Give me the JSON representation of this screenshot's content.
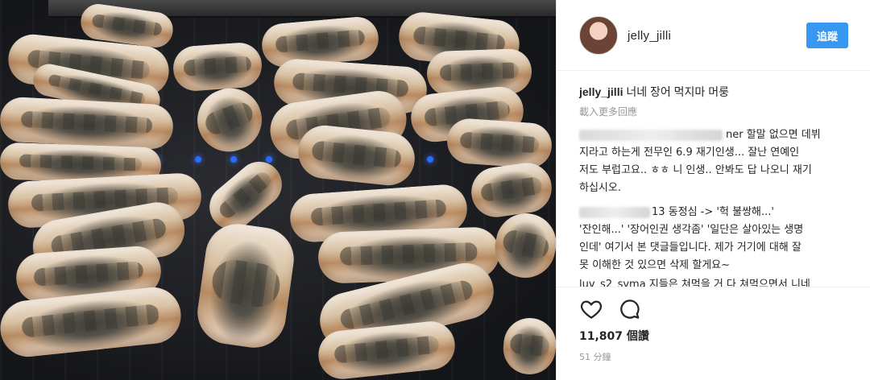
{
  "post": {
    "username": "jelly_jilli",
    "follow_label": "追蹤",
    "caption_user": "jelly_jilli",
    "caption_text": " 너네 장어 먹지마 머룽",
    "load_more_label": "載入更多回應"
  },
  "comments": [
    {
      "lines": [
        "ner 할말 없으면 데뷔",
        "지라고 하는게 전무인 6.9 재기인생... 잘난 연예인",
        "저도 부럽고요.. ㅎㅎ 니 인생.. 안봐도 답 나오니 재기",
        "하십시오."
      ]
    },
    {
      "lines": [
        "13 동정심 -> '헉 불쌍해...'",
        "'잔인해...' '장어인권 생각좀' '일단은 살아있는 생명",
        "인데' 여기서 본 댓글들입니다. 제가 거기에 대해 잘",
        "못 이해한 것 있으면 삭제 할게요~"
      ]
    },
    {
      "lines": [
        "luv_s2_syma 지들은 쳐먹을 거 다 쳐먹으면서 니네"
      ]
    }
  ],
  "actions": {
    "likes": "11,807 個讚",
    "time": "51 分鐘"
  },
  "colors": {
    "follow_button": "#3897f0",
    "text": "#262626",
    "muted": "#999999"
  },
  "icons": {
    "like": "heart-icon",
    "comment": "comment-icon"
  }
}
